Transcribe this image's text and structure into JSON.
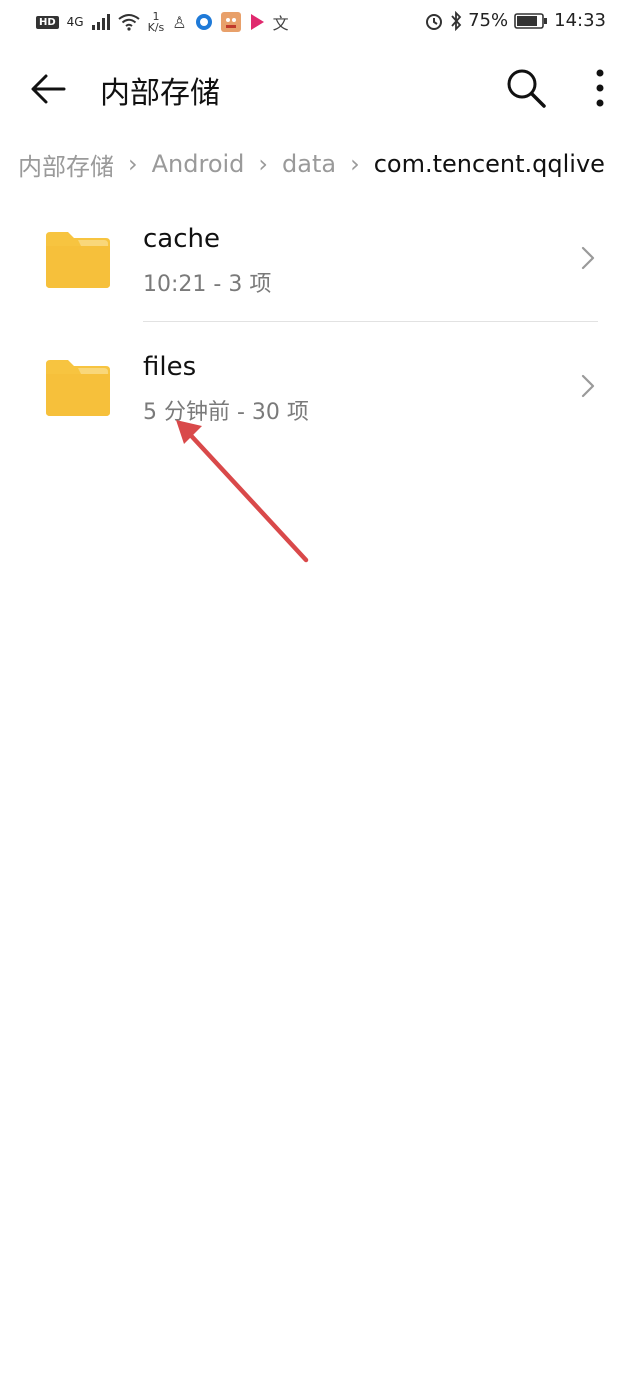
{
  "status_bar": {
    "hd": "HD",
    "network": "4G",
    "speed_value": "1",
    "speed_unit": "K/s",
    "battery": "75%",
    "time": "14:33"
  },
  "toolbar": {
    "title": "内部存储"
  },
  "breadcrumb": [
    {
      "label": "内部存储"
    },
    {
      "label": "Android"
    },
    {
      "label": "data"
    },
    {
      "label": "com.tencent.qqlive"
    }
  ],
  "files": [
    {
      "name": "cache",
      "meta": "10:21 - 3 项"
    },
    {
      "name": "files",
      "meta": "5 分钟前 - 30 项"
    }
  ],
  "colors": {
    "folder": "#F7C440",
    "folder_tab": "#F9D77A",
    "annotation": "#D9494A"
  }
}
